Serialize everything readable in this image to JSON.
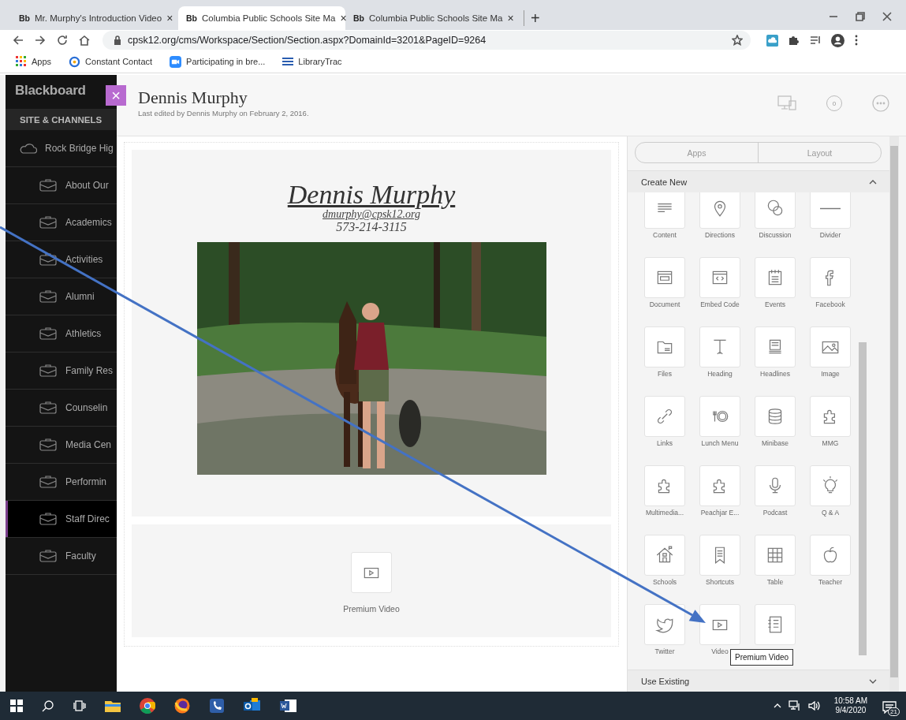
{
  "browser": {
    "tabs": [
      {
        "favicon": "Bb",
        "title": "Mr. Murphy's Introduction Video",
        "close": "×",
        "selected": false
      },
      {
        "favicon": "Bb",
        "title": "Columbia Public Schools Site Ma",
        "close": "×",
        "selected": true
      },
      {
        "favicon": "Bb",
        "title": "Columbia Public Schools Site Ma",
        "close": "×",
        "selected": false
      }
    ],
    "new_tab": "+",
    "address": "cpsk12.org/cms/Workspace/Section/Section.aspx?DomainId=3201&PageID=9264",
    "bookmarks": [
      {
        "label": "Apps"
      },
      {
        "label": "Constant Contact"
      },
      {
        "label": "Participating in bre..."
      },
      {
        "label": "LibraryTrac"
      }
    ]
  },
  "sidebar": {
    "logo": "Blackboard",
    "section": "SITE & CHANNELS",
    "items": [
      {
        "kind": "site",
        "label": "Rock Bridge Hig",
        "selected": false
      },
      {
        "kind": "channel",
        "label": "About Our",
        "selected": false
      },
      {
        "kind": "channel",
        "label": "Academics",
        "selected": false
      },
      {
        "kind": "channel",
        "label": "Activities",
        "selected": false
      },
      {
        "kind": "channel",
        "label": "Alumni",
        "selected": false
      },
      {
        "kind": "channel",
        "label": "Athletics",
        "selected": false
      },
      {
        "kind": "channel",
        "label": "Family Res",
        "selected": false
      },
      {
        "kind": "channel",
        "label": "Counselin",
        "selected": false
      },
      {
        "kind": "channel",
        "label": "Media Cen",
        "selected": false
      },
      {
        "kind": "channel",
        "label": "Performin",
        "selected": false
      },
      {
        "kind": "channel",
        "label": "Staff Direc",
        "selected": true
      },
      {
        "kind": "channel",
        "label": "Faculty",
        "selected": false
      }
    ]
  },
  "header": {
    "close": "×",
    "title": "Dennis Murphy",
    "subtitle": "Last edited by Dennis Murphy on February 2, 2016.",
    "comment_count": "0"
  },
  "content": {
    "heading": "Dennis Murphy",
    "email": "dmurphy@cpsk12.org",
    "phone": "573-214-3115",
    "video_block": {
      "label": "Premium Video"
    }
  },
  "panel": {
    "tabs": [
      {
        "label": "Apps"
      },
      {
        "label": "Layout"
      }
    ],
    "create_new": {
      "title": "Create New",
      "expanded": true
    },
    "apps": [
      {
        "kind": "app",
        "label": "Content"
      },
      {
        "kind": "app",
        "label": "Directions"
      },
      {
        "kind": "app",
        "label": "Discussion"
      },
      {
        "kind": "app",
        "label": "Divider"
      },
      {
        "kind": "app",
        "label": "Document"
      },
      {
        "kind": "app",
        "label": "Embed Code"
      },
      {
        "kind": "app",
        "label": "Events"
      },
      {
        "kind": "app",
        "label": "Facebook"
      },
      {
        "kind": "app",
        "label": "Files"
      },
      {
        "kind": "app",
        "label": "Heading"
      },
      {
        "kind": "app",
        "label": "Headlines"
      },
      {
        "kind": "app",
        "label": "Image"
      },
      {
        "kind": "app",
        "label": "Links"
      },
      {
        "kind": "app",
        "label": "Lunch Menu"
      },
      {
        "kind": "app",
        "label": "Minibase"
      },
      {
        "kind": "app",
        "label": "MMG"
      },
      {
        "kind": "app",
        "label": "Multimedia..."
      },
      {
        "kind": "app",
        "label": "Peachjar E..."
      },
      {
        "kind": "app",
        "label": "Podcast"
      },
      {
        "kind": "app",
        "label": "Q & A"
      },
      {
        "kind": "app",
        "label": "Schools"
      },
      {
        "kind": "app",
        "label": "Shortcuts"
      },
      {
        "kind": "app",
        "label": "Table"
      },
      {
        "kind": "app",
        "label": "Teacher"
      },
      {
        "kind": "app",
        "label": "Twitter"
      },
      {
        "kind": "app",
        "label": "Video"
      },
      {
        "kind": "covered"
      }
    ],
    "tooltip": "Premium Video",
    "use_existing": {
      "title": "Use Existing",
      "expanded": false
    }
  },
  "taskbar": {
    "time": "10:58 AM",
    "date": "9/4/2020",
    "notifications": "21"
  }
}
